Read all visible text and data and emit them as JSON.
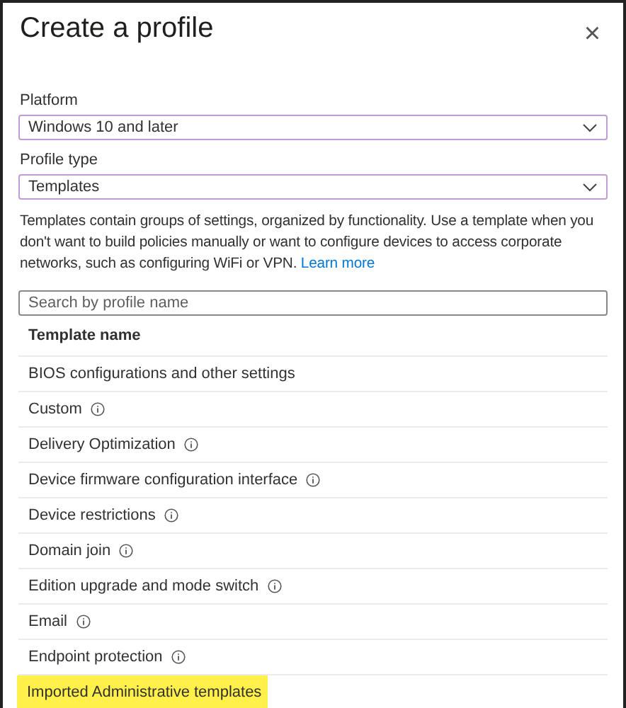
{
  "panel": {
    "title": "Create a profile",
    "close_icon": "×"
  },
  "fields": [
    {
      "label": "Platform",
      "value": "Windows 10 and later"
    },
    {
      "label": "Profile type",
      "value": "Templates"
    }
  ],
  "description": {
    "text": "Templates contain groups of settings, organized by functionality. Use a template when you don't want to build policies manually or want to configure devices to access corporate networks, such as configuring WiFi or VPN.",
    "link": "Learn more"
  },
  "search": {
    "placeholder": "Search by profile name"
  },
  "table": {
    "columns": [
      "Template name"
    ],
    "rows": [
      {
        "name": "BIOS configurations and other settings",
        "info": false,
        "highlighted": false
      },
      {
        "name": "Custom",
        "info": true,
        "highlighted": false
      },
      {
        "name": "Delivery Optimization",
        "info": true,
        "highlighted": false
      },
      {
        "name": "Device firmware configuration interface",
        "info": true,
        "highlighted": false
      },
      {
        "name": "Device restrictions",
        "info": true,
        "highlighted": false
      },
      {
        "name": "Domain join",
        "info": true,
        "highlighted": false
      },
      {
        "name": "Edition upgrade and mode switch",
        "info": true,
        "highlighted": false
      },
      {
        "name": "Email",
        "info": true,
        "highlighted": false
      },
      {
        "name": "Endpoint protection",
        "info": true,
        "highlighted": false
      },
      {
        "name": "Imported Administrative templates",
        "info": false,
        "highlighted": true
      }
    ]
  }
}
